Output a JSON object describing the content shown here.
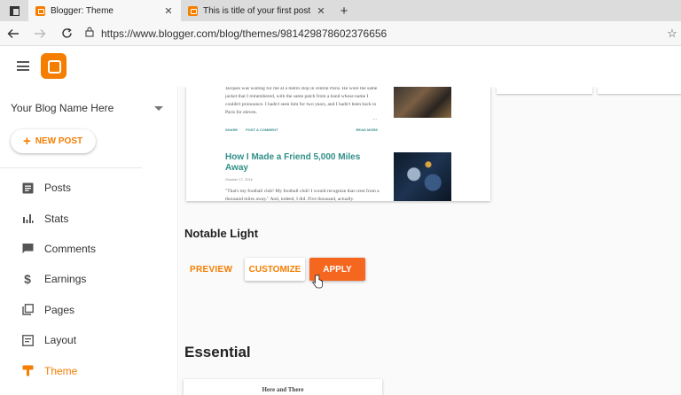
{
  "browser": {
    "tabs": [
      {
        "title": "Blogger: Theme",
        "active": true
      },
      {
        "title": "This is title of your first post",
        "active": false
      }
    ],
    "close_glyph": "✕",
    "new_tab_glyph": "+",
    "url": "https://www.blogger.com/blog/themes/9814298786023766 56",
    "url_clean": "https://www.blogger.com/blog/themes/981429878602376656"
  },
  "sidebar": {
    "blog_name": "Your Blog Name Here",
    "new_post_label": "NEW POST",
    "new_post_icon": "+",
    "items": [
      {
        "label": "Posts",
        "icon": "posts-icon"
      },
      {
        "label": "Stats",
        "icon": "stats-icon"
      },
      {
        "label": "Comments",
        "icon": "comments-icon"
      },
      {
        "label": "Earnings",
        "icon": "earnings-icon"
      },
      {
        "label": "Pages",
        "icon": "pages-icon"
      },
      {
        "label": "Layout",
        "icon": "layout-icon"
      },
      {
        "label": "Theme",
        "icon": "theme-icon",
        "selected": true
      }
    ]
  },
  "preview": {
    "excerpt1": "Jacques was waiting for me at a metro stop in central Paris. He wore the same jacket that I remembered, with the same patch from a band whose name I couldn't pronounce. I hadn't seen him for two years, and I hadn't been back to Paris for eleven.",
    "ellipsis": "...",
    "share_label": "SHARE",
    "comment_label": "POST A COMMENT",
    "read_more_label": "READ MORE",
    "post2_title": "How I Made a Friend 5,000 Miles Away",
    "post2_date": "October 17, 2016",
    "excerpt2": "\"That's my football club! My football club! I would recognize that crest from a thousand miles away.\" And, indeed, I did. Five thousand, actually."
  },
  "theme": {
    "name": "Notable Light",
    "preview_label": "PREVIEW",
    "customize_label": "CUSTOMIZE",
    "apply_label": "APPLY"
  },
  "section": {
    "title": "Essential",
    "card_title": "Here and There"
  },
  "colors": {
    "accent": "#f57d00",
    "apply_bg": "#f5661f",
    "teal": "#2f8f89"
  }
}
